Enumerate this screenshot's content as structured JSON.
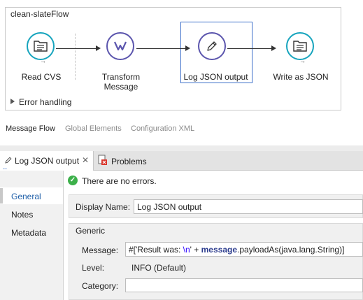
{
  "flow": {
    "title": "clean-slateFlow",
    "nodes": [
      {
        "label": "Read CVS",
        "icon": "file-folder-icon"
      },
      {
        "label": "Transform\nMessage",
        "icon": "dataweave-icon"
      },
      {
        "label": "Log JSON output",
        "icon": "pencil-icon"
      },
      {
        "label": "Write as JSON",
        "icon": "file-folder-icon"
      }
    ],
    "error_handling": "Error handling"
  },
  "editor_tabs": [
    "Message Flow",
    "Global Elements",
    "Configuration XML"
  ],
  "panel": {
    "tabs": [
      {
        "label": "Log JSON output",
        "close": "✕"
      },
      {
        "label": "Problems"
      }
    ],
    "nav": [
      "General",
      "Notes",
      "Metadata"
    ],
    "status": "There are no errors.",
    "display_name_label": "Display Name:",
    "display_name_value": "Log JSON output",
    "group_title": "Generic",
    "message_label": "Message:",
    "message_parts": {
      "p1": "#['Result was: ",
      "p2": "\\n",
      "p3": "' + ",
      "p4": "message",
      "p5": ".payloadAs(java.lang.String)]"
    },
    "level_label": "Level:",
    "level_value": "INFO (Default)",
    "category_label": "Category:",
    "category_value": ""
  },
  "colors": {
    "teal": "#16a4bd",
    "purple": "#5b55ad",
    "selection": "#3c6fc9",
    "ok": "#3cb04a"
  }
}
